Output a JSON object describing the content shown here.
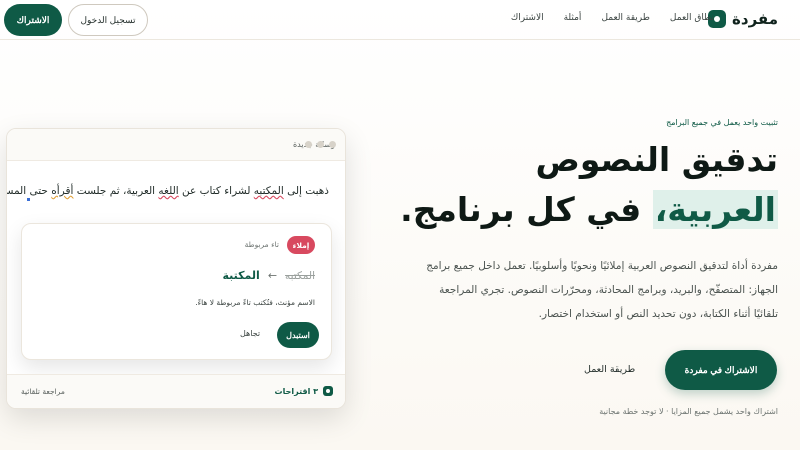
{
  "header": {
    "logo_text": "مفردة",
    "nav": [
      "نطاق العمل",
      "طريقة العمل",
      "أمثلة",
      "الاشتراك"
    ],
    "login_label": "تسجيل الدخول",
    "signup_label": "الاشتراك"
  },
  "hero": {
    "eyebrow": "تثبيت واحد يعمل في جميع البرامج",
    "headline_line1": "تدقيق النصوص",
    "headline_highlight": "العربية،",
    "headline_rest": " في كل برنامج.",
    "description": "مفردة أداة لتدقيق النصوص العربية إملائيًا ونحويًا وأسلوبيًا. تعمل داخل جميع برامج الجهاز: المتصفّح، والبريد، وبرامج المحادثة، ومحرّرات النصوص. تجري المراجعة تلقائيًا أثناء الكتابة، دون تحديد النص أو استخدام اختصار.",
    "cta_label": "الاشتراك في مفردة",
    "secondary_label": "طريقة العمل",
    "fineprint": "اشتراك واحد يشمل جميع المزايا · لا توجد خطة مجانية"
  },
  "demo_window": {
    "title": "رسالة جديدة",
    "text_before": "ذهبت إلى ",
    "error1": "المكتبه",
    "text_mid1": " لشراء كتاب عن ",
    "error2": "اللغه",
    "text_mid2": " العربية، ثم جلست ",
    "error3": "أقرأه",
    "text_after": " حتى المساء.",
    "suggestion": {
      "badge": "إملاء",
      "rule": "تاء مربوطة",
      "old_word": "المكتبه",
      "arrow": "←",
      "new_word": "المكتبة",
      "explanation": "الاسم مؤنث، فتُكتب تاءً مربوطة لا هاءً.",
      "replace_label": "استبدل",
      "ignore_label": "تجاهل"
    },
    "footer_count": "٣ اقتراحات",
    "footer_auto": "مراجعة تلقائية"
  }
}
